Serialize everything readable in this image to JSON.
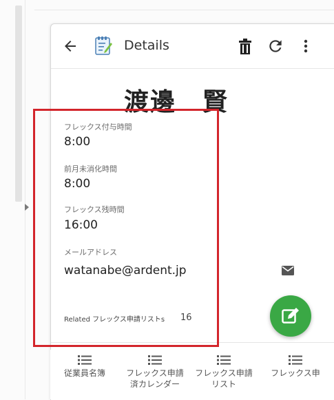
{
  "toolbar": {
    "title": "Details"
  },
  "employee": {
    "name": "渡邊　賢"
  },
  "fields": [
    {
      "label": "フレックス付与時間",
      "value": "8:00"
    },
    {
      "label": "前月未消化時間",
      "value": "8:00"
    },
    {
      "label": "フレックス残時間",
      "value": "16:00"
    },
    {
      "label": "メールアドレス",
      "value": "watanabe@ardent.jp"
    }
  ],
  "related": {
    "label": "Related フレックス申請リストs",
    "count": "16"
  },
  "bottom_nav": [
    {
      "label": "従業員名簿"
    },
    {
      "label": "フレックス申請\n済カレンダー"
    },
    {
      "label": "フレックス申請\nリスト"
    },
    {
      "label": "フレックス申"
    }
  ],
  "colors": {
    "fab": "#3aa845",
    "highlight": "#d3252b"
  },
  "icons": [
    "arrow-back-icon",
    "notepad-icon",
    "trash-icon",
    "refresh-icon",
    "more-vert-icon",
    "email-icon",
    "edit-icon",
    "list-icon"
  ]
}
